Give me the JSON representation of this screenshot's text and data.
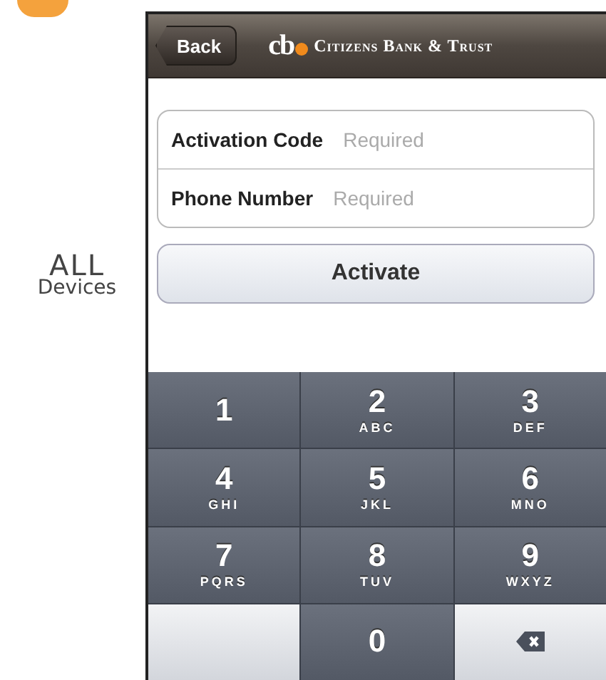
{
  "side_label": {
    "line1": "ALL",
    "line2": "Devices"
  },
  "nav_bar": {
    "back_button": "Back",
    "logo_mark": "cb",
    "title": "Citizens Bank & Trust"
  },
  "form": {
    "fields": [
      {
        "label": "Activation Code",
        "placeholder": "Required"
      },
      {
        "label": "Phone Number",
        "placeholder": "Required"
      }
    ],
    "button": "Activate"
  },
  "keypad": [
    {
      "kind": "digit",
      "digit": "1"
    },
    {
      "kind": "digit",
      "digit": "2",
      "letters": "ABC"
    },
    {
      "kind": "digit",
      "digit": "3",
      "letters": "DEF"
    },
    {
      "kind": "digit",
      "digit": "4",
      "letters": "GHI"
    },
    {
      "kind": "digit",
      "digit": "5",
      "letters": "JKL"
    },
    {
      "kind": "digit",
      "digit": "6",
      "letters": "MNO"
    },
    {
      "kind": "digit",
      "digit": "7",
      "letters": "PQRS"
    },
    {
      "kind": "digit",
      "digit": "8",
      "letters": "TUV"
    },
    {
      "kind": "digit",
      "digit": "9",
      "letters": "WXYZ"
    },
    {
      "kind": "blank"
    },
    {
      "kind": "digit",
      "digit": "0"
    },
    {
      "kind": "delete"
    }
  ]
}
